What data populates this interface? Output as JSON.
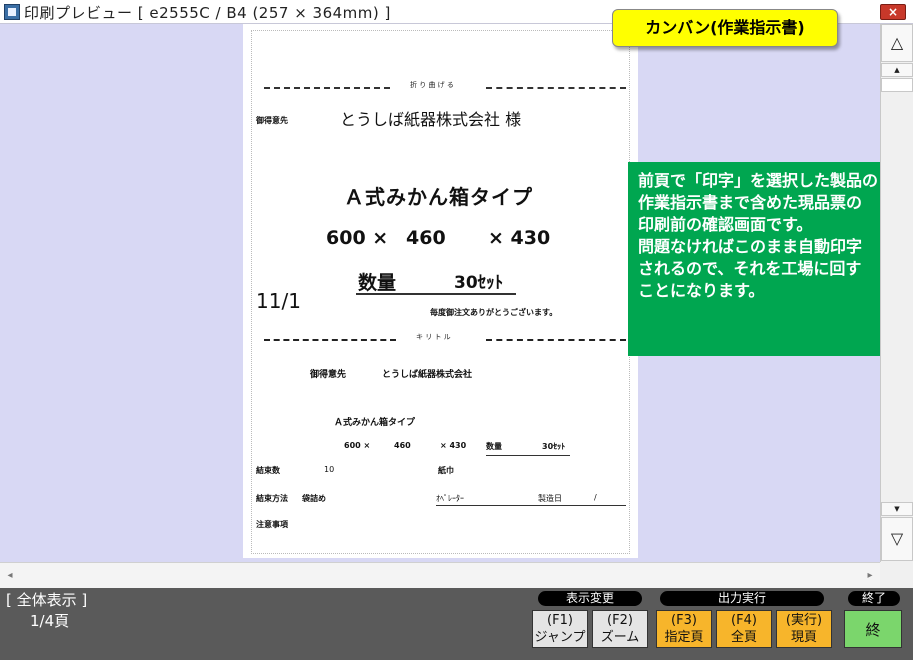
{
  "window": {
    "title": "印刷プレビュー [ e2555C / B4 (257 × 364mm) ]",
    "close_label": "×"
  },
  "callouts": {
    "kanban": "カンバン(作業指示書)",
    "note_lines": [
      "前頁で「印字」を選択した製品の",
      "作業指示書まで含めた現品票の",
      "印刷前の確認画面です。",
      "問題なければこのまま自動印字",
      "されるので、それを工場に回す",
      "ことになります。"
    ]
  },
  "document": {
    "fold_label": "折 り 曲 げ る",
    "cut_label": "キ リ ト ル",
    "top": {
      "customer_label": "御得意先",
      "customer_name": "とうしば紙器株式会社 様",
      "product": "Ａ式みかん箱タイプ",
      "dim_w": "600 ×",
      "dim_d": "460",
      "dim_h": "× 430",
      "qty_label": "数量",
      "qty_value": "30ｾｯﾄ",
      "date": "11/1",
      "thanks": "毎度御注文ありがとうございます。"
    },
    "bottom": {
      "customer_label": "御得意先",
      "customer_name": "とうしば紙器株式会社",
      "product": "Ａ式みかん箱タイプ",
      "dim_w": "600 ×",
      "dim_d": "460",
      "dim_h": "× 430",
      "qty_label": "数量",
      "qty_value": "30ｾｯﾄ",
      "bundle_count_label": "結束数",
      "bundle_count": "10",
      "bundle_material": "紙巾",
      "bundle_method_label": "結束方法",
      "bundle_method": "袋詰め",
      "operator_label": "ｵﾍﾟﾚｰﾀｰ",
      "manufacture_date_label": "製造日",
      "manufacture_date_sep": "/",
      "notes_label": "注意事項"
    }
  },
  "scrollbar": {
    "top_icon": "△",
    "up_icon": "▲",
    "down_icon": "▼",
    "bottom_icon": "▽",
    "left_icon": "◂",
    "right_icon": "▸"
  },
  "toolbar": {
    "view_mode": "[ 全体表示 ]",
    "page_indicator": "1/4頁",
    "group_display": "表示変更",
    "group_output": "出力実行",
    "group_exit": "終了",
    "f1_key": "(F1)",
    "f1_label": "ジャンプ",
    "f2_key": "(F2)",
    "f2_label": "ズーム",
    "f3_key": "(F3)",
    "f3_label": "指定頁",
    "f4_key": "(F4)",
    "f4_label": "全頁",
    "exec_key": "(実行)",
    "exec_label": "現頁",
    "end_label": "終"
  }
}
